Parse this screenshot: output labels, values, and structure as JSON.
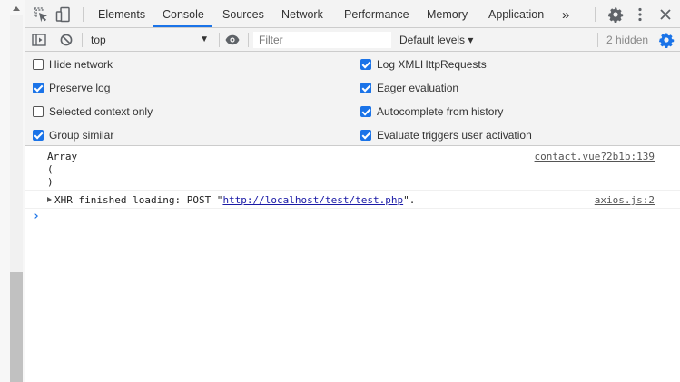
{
  "toolbar": {
    "tabs": [
      "Elements",
      "Console",
      "Sources",
      "Network",
      "Performance",
      "Memory",
      "Application"
    ],
    "active_tab": "Console",
    "more_tabs": "»"
  },
  "console_toolbar": {
    "context": "top",
    "filter_placeholder": "Filter",
    "levels": "Default levels ▾",
    "hidden": "2 hidden"
  },
  "settings": {
    "left": [
      {
        "label": "Hide network",
        "checked": false
      },
      {
        "label": "Preserve log",
        "checked": true
      },
      {
        "label": "Selected context only",
        "checked": false
      },
      {
        "label": "Group similar",
        "checked": true
      }
    ],
    "right": [
      {
        "label": "Log XMLHttpRequests",
        "checked": true
      },
      {
        "label": "Eager evaluation",
        "checked": true
      },
      {
        "label": "Autocomplete from history",
        "checked": true
      },
      {
        "label": "Evaluate triggers user activation",
        "checked": true
      }
    ]
  },
  "messages": [
    {
      "lines": [
        "Array",
        "(",
        ")"
      ],
      "source": "contact.vue?2b1b:139"
    },
    {
      "prefix": "XHR finished loading: POST \"",
      "url": "http://localhost/test/test.php",
      "suffix": "\".",
      "source": "axios.js:2"
    }
  ],
  "prompt": "›",
  "colors": {
    "accent": "#1a73e8",
    "toolbar_bg": "#f3f3f3",
    "border": "#cccccc"
  },
  "icons": [
    "inspect-element-icon",
    "device-toolbar-icon",
    "settings-gear-icon",
    "kebab-menu-icon",
    "close-icon",
    "sidebar-toggle-icon",
    "clear-console-icon",
    "eye-icon",
    "console-settings-gear-icon"
  ]
}
